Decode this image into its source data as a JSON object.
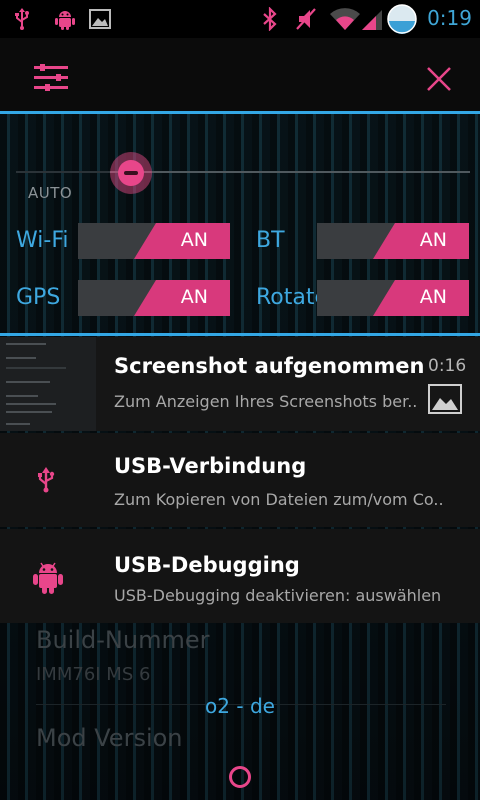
{
  "status_bar": {
    "time": "0:19",
    "icons": [
      "usb-icon",
      "android-debug-icon",
      "image-icon",
      "bluetooth-icon",
      "vibrate-off-icon",
      "wifi-icon",
      "signal-icon",
      "battery-icon"
    ]
  },
  "header": {
    "settings_icon": "settings-sliders-icon",
    "close_icon": "close-icon"
  },
  "quick_settings": {
    "brightness": {
      "auto_label": "AUTO",
      "level": 0.0
    },
    "toggles": [
      {
        "label": "Wi-Fi",
        "state": "AN"
      },
      {
        "label": "BT",
        "state": "AN"
      },
      {
        "label": "GPS",
        "state": "AN"
      },
      {
        "label": "Rotate",
        "state": "AN"
      }
    ]
  },
  "notifications": [
    {
      "title": "Screenshot aufgenommen",
      "text": "Zum Anzeigen Ihres Screenshots ber..",
      "time": "0:16",
      "icon": "screenshot-thumbnail"
    },
    {
      "title": "USB-Verbindung",
      "text": "Zum Kopieren von Dateien zum/vom Co..",
      "icon": "usb-icon"
    },
    {
      "title": "USB-Debugging",
      "text": "USB-Debugging deaktivieren: auswählen",
      "icon": "android-icon"
    }
  ],
  "background": {
    "build_label": "Build-Nummer",
    "build_value": "IMM76I MS 6",
    "mod_label": "Mod Version"
  },
  "carrier": "o2 - de",
  "colors": {
    "accent": "#e8468a",
    "holo_blue": "#33a7e5"
  }
}
